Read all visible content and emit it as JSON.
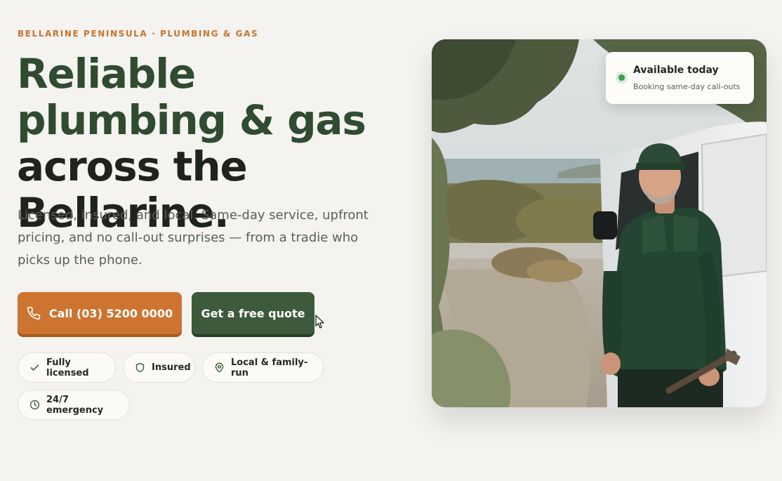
{
  "hero": {
    "eyebrow": "BELLARINE PENINSULA · PLUMBING & GAS",
    "headline_green": "Reliable plumbing & gas",
    "headline_dark": " across the Bellarine.",
    "subtext": "Licensed, insured, and local. Same-day service, upfront pricing, and no call-out surprises — from a tradie who picks up the phone."
  },
  "buttons": {
    "call_label": "Call (03) 5200 0000",
    "quote_label": "Get a free quote"
  },
  "badges": [
    {
      "label": "Fully licensed",
      "icon": "check-icon"
    },
    {
      "label": "Insured",
      "icon": "shield-icon"
    },
    {
      "label": "Local & family-run",
      "icon": "map-pin-icon"
    },
    {
      "label": "24/7 emergency",
      "icon": "clock-icon"
    }
  ],
  "availability": {
    "title": "Available today",
    "subtitle": "Booking same-day call-outs",
    "status_color": "#3d9b52"
  },
  "colors": {
    "accent_orange": "#cc7430",
    "brand_green": "#3d5a3c",
    "background": "#f4f3ef"
  }
}
